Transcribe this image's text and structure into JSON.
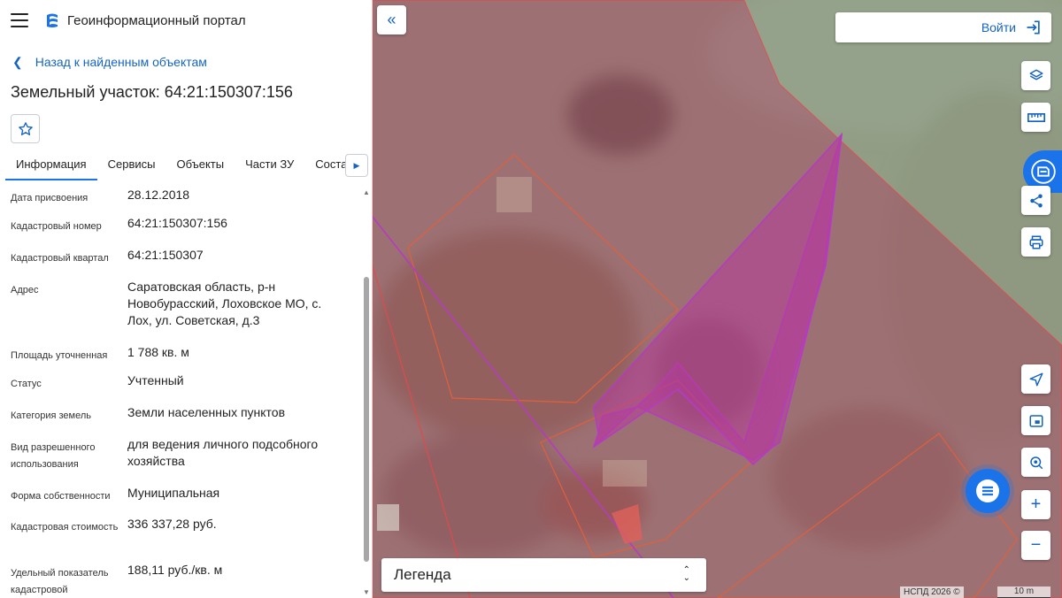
{
  "app": {
    "title": "Геоинформационный портал"
  },
  "nav": {
    "back_label": "Назад к найденным объектам"
  },
  "object": {
    "title": "Земельный участок: 64:21:150307:156"
  },
  "tabs": [
    {
      "label": "Информация"
    },
    {
      "label": "Сервисы"
    },
    {
      "label": "Объекты"
    },
    {
      "label": "Части ЗУ"
    },
    {
      "label": "Состав"
    }
  ],
  "info": [
    {
      "label": "Дата присвоения",
      "value": "28.12.2018"
    },
    {
      "label": "Кадастровый номер",
      "value": "64:21:150307:156"
    },
    {
      "label": "Кадастровый квартал",
      "value": "64:21:150307"
    },
    {
      "label": "Адрес",
      "value": "Саратовская область, р-н Новобурасский, Лоховское МО, с. Лох, ул. Советская, д.3"
    },
    {
      "label": "Площадь уточненная",
      "value": "1 788 кв. м"
    },
    {
      "label": "Статус",
      "value": "Учтенный"
    },
    {
      "label": "Категория земель",
      "value": "Земли населенных пунктов"
    },
    {
      "label": "Вид разрешенного использования",
      "value": "для ведения личного подсобного хозяйства"
    },
    {
      "label": "Форма собственности",
      "value": "Муниципальная"
    },
    {
      "label": "Кадастровая стоимость",
      "value": "336 337,28 руб."
    },
    {
      "label": "Удельный показатель кадастровой",
      "value": "188,11 руб./кв. м"
    }
  ],
  "map": {
    "login_label": "Войти",
    "legend_label": "Легенда",
    "attribution": "НСПД 2026 ©",
    "scale_label": "10 m"
  },
  "colors": {
    "accent": "#1a73e8",
    "link": "#1565c0",
    "parcel_fill": "#b0586f",
    "selected_fill": "#b43c9a",
    "parcel_border": "#e04a4a"
  },
  "icons": {
    "collapse": "double-chevron-left-icon",
    "layers": "layers-icon",
    "ruler": "ruler-icon",
    "share": "share-icon",
    "print": "print-icon",
    "locate": "navigation-arrow-icon",
    "minimap": "minimap-icon",
    "geo": "geo-pin-icon",
    "zoom_in": "plus-icon",
    "zoom_out": "minus-icon",
    "chat": "chat-icon"
  }
}
